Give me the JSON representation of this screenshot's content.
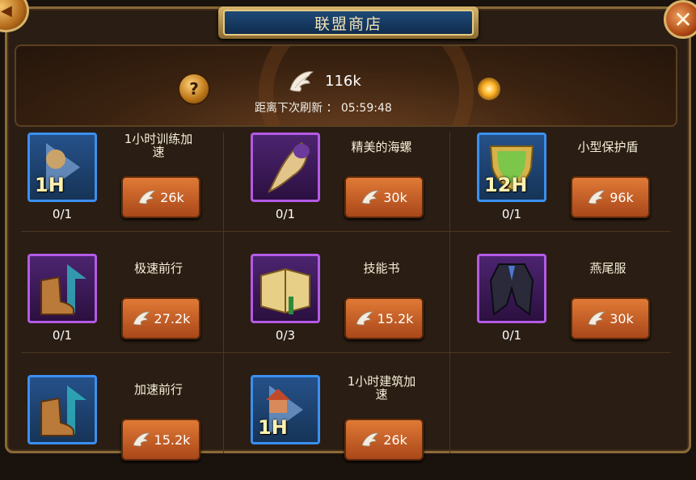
{
  "window": {
    "title": "联盟商店"
  },
  "currency": {
    "amount": "116k"
  },
  "refresh": {
    "text": "距离下次刷新 ： 05:59:48"
  },
  "items": [
    {
      "name": "1小时训练加\n速",
      "count": "0/1",
      "price": "26k",
      "icon": "training-speedup-icon",
      "frame": "blue",
      "badge": "1H"
    },
    {
      "name": "精美的海螺",
      "count": "0/1",
      "price": "30k",
      "icon": "conch-shell-icon",
      "frame": "purple",
      "badge": ""
    },
    {
      "name": "小型保护盾",
      "count": "0/1",
      "price": "96k",
      "icon": "shield-icon",
      "frame": "blue",
      "badge": "12H"
    },
    {
      "name": "极速前行",
      "count": "0/1",
      "price": "27.2k",
      "icon": "boots-icon",
      "frame": "purple",
      "badge": ""
    },
    {
      "name": "技能书",
      "count": "0/3",
      "price": "15.2k",
      "icon": "skill-book-icon",
      "frame": "purple",
      "badge": ""
    },
    {
      "name": "燕尾服",
      "count": "0/1",
      "price": "30k",
      "icon": "tailcoat-icon",
      "frame": "purple",
      "badge": ""
    },
    {
      "name": "加速前行",
      "count": "",
      "price": "15.2k",
      "icon": "boots-icon",
      "frame": "blue",
      "badge": ""
    },
    {
      "name": "1小时建筑加\n速",
      "count": "",
      "price": "26k",
      "icon": "building-speedup-icon",
      "frame": "blue",
      "badge": "1H"
    }
  ]
}
